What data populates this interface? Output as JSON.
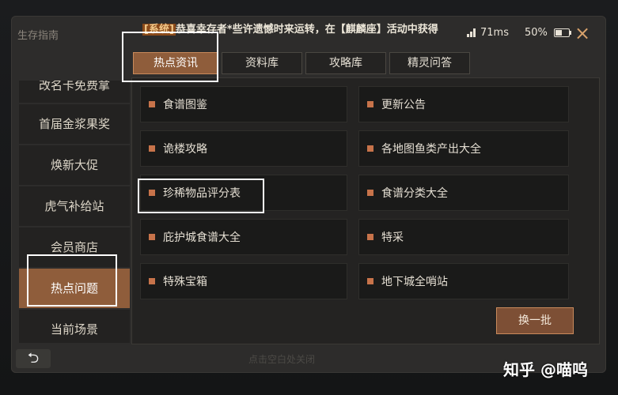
{
  "topbar": {
    "title": "生存指南",
    "broadcast_tag": "[系统]",
    "broadcast_text": "恭喜幸存者*些许遗憾时来运转，在【麒麟座】活动中获得",
    "ping": "71ms",
    "battery": "50%",
    "close_icon": "×"
  },
  "tabs": [
    {
      "label": "热点资讯",
      "active": true
    },
    {
      "label": "资料库",
      "active": false
    },
    {
      "label": "攻略库",
      "active": false
    },
    {
      "label": "精灵问答",
      "active": false
    }
  ],
  "sidebar": {
    "items": [
      {
        "label": "改名卡免费拿"
      },
      {
        "label": "首届金浆果奖"
      },
      {
        "label": "焕新大促"
      },
      {
        "label": "虎气补给站"
      },
      {
        "label": "会员商店"
      },
      {
        "label": "热点问题",
        "active": true
      },
      {
        "label": "当前场景"
      }
    ]
  },
  "grid": {
    "cells": [
      {
        "label": "食谱图鉴"
      },
      {
        "label": "更新公告"
      },
      {
        "label": "诡楼攻略"
      },
      {
        "label": "各地图鱼类产出大全"
      },
      {
        "label": "珍稀物品评分表"
      },
      {
        "label": "食谱分类大全"
      },
      {
        "label": "庇护城食谱大全"
      },
      {
        "label": "特采"
      },
      {
        "label": "特殊宝箱"
      },
      {
        "label": "地下城全哨站"
      }
    ]
  },
  "refresh_label": "换一批",
  "bottom": {
    "back_icon": "⮌",
    "hint": "点击空白处关闭"
  },
  "watermark": "知乎 @喵呜",
  "colors": {
    "accent": "#8f5d3b",
    "bullet": "#c7734a",
    "panel": "#2d2c2b"
  }
}
